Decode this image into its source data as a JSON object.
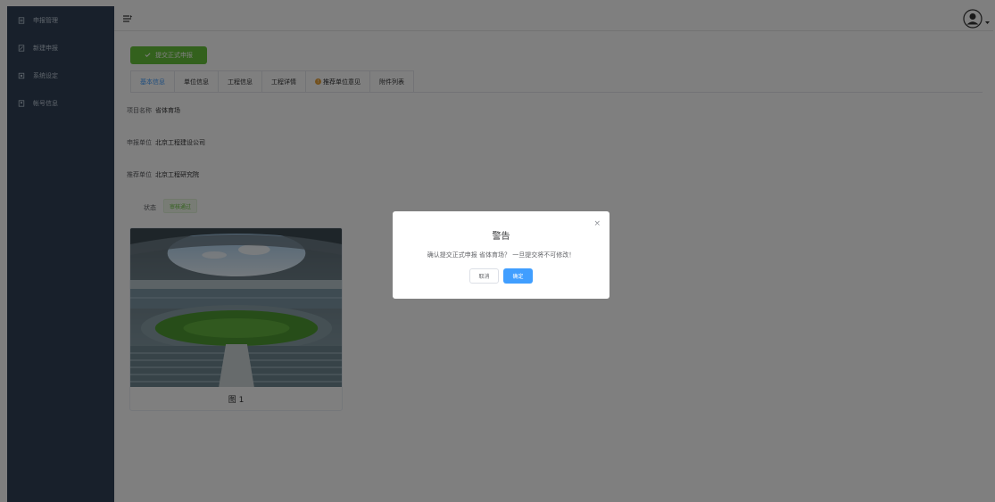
{
  "sidebar": {
    "items": [
      {
        "label": "申报管理",
        "icon": "document-icon"
      },
      {
        "label": "新建申报",
        "icon": "document-edit-icon"
      },
      {
        "label": "系统设定",
        "icon": "settings-icon"
      },
      {
        "label": "帐号信息",
        "icon": "account-icon"
      }
    ]
  },
  "toolbar": {
    "submit_label": "提交正式申报"
  },
  "tabs": [
    "基本信息",
    "单位信息",
    "工程信息",
    "工程详情",
    "推荐单位意见",
    "附件列表"
  ],
  "fields": {
    "project_name_label": "项目名称",
    "project_name": "省体育场",
    "applicant_label": "申报单位",
    "applicant": "北京工程建设公司",
    "recommender_label": "推荐单位",
    "recommender": "北京工程研究院",
    "status_label": "状态",
    "status": "审核通过"
  },
  "image_card": {
    "caption": "图 1"
  },
  "dialog": {
    "title": "警告",
    "message": "确认提交正式申报 省体育场？ 一旦提交将不可修改！",
    "cancel_label": "取消",
    "confirm_label": "确定",
    "close_glyph": "×"
  },
  "colors": {
    "sidebar_bg": "#304156",
    "success": "#67c23a",
    "primary": "#409eff",
    "warning": "#e6a23c"
  }
}
